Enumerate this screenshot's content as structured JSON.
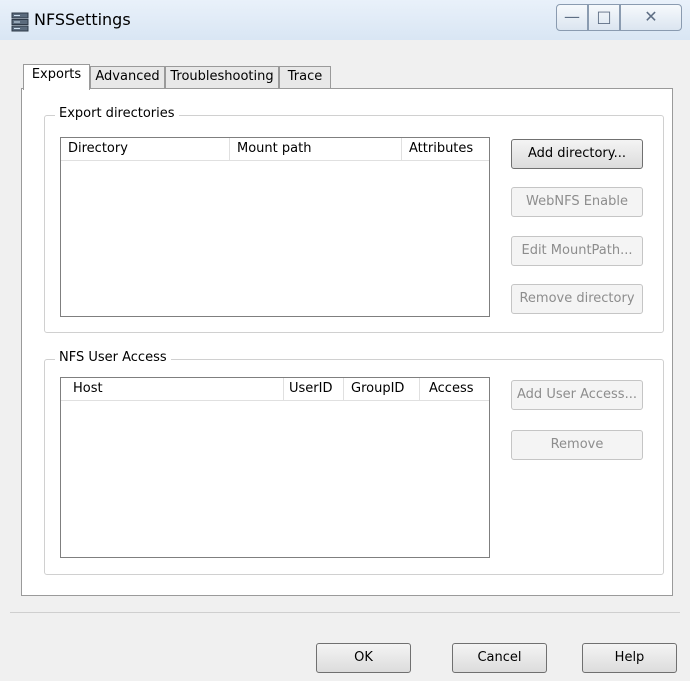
{
  "window": {
    "title": "NFSSettings"
  },
  "tabs": [
    {
      "label": "Exports",
      "active": true
    },
    {
      "label": "Advanced",
      "active": false
    },
    {
      "label": "Troubleshooting",
      "active": false
    },
    {
      "label": "Trace",
      "active": false
    }
  ],
  "export_directories": {
    "legend": "Export directories",
    "columns": [
      "Directory",
      "Mount path",
      "Attributes"
    ],
    "rows": [],
    "buttons": {
      "add": "Add directory...",
      "webnfs": "WebNFS Enable",
      "edit": "Edit MountPath...",
      "remove": "Remove directory"
    }
  },
  "nfs_user_access": {
    "legend": "NFS User Access",
    "columns": [
      "Host",
      "UserID",
      "GroupID",
      "Access"
    ],
    "rows": [],
    "buttons": {
      "add": "Add User Access...",
      "remove": "Remove"
    }
  },
  "footer": {
    "ok": "OK",
    "cancel": "Cancel",
    "help": "Help"
  }
}
